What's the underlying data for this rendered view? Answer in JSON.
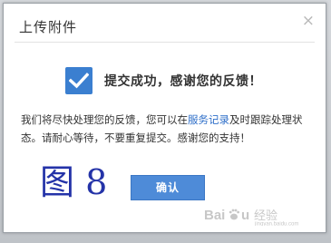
{
  "dialog": {
    "title": "上传附件",
    "close_glyph": "×",
    "success_message": "提交成功，感谢您的反馈！",
    "body_before_link": "我们将尽快处理您的反馈，您可以在",
    "body_link": "服务记录",
    "body_after_link": "及时跟踪处理状态。请耐心等待，不要重复提交。感谢您的支持！",
    "confirm_label": "确认"
  },
  "annotation": {
    "text": "图 8"
  },
  "watermark": {
    "text": "Bai 经验 jingyan.baidu.com"
  },
  "colors": {
    "accent": "#3b7fd0",
    "button": "#4e8bd8",
    "link": "#2f6fc9",
    "annotation": "#2433a8"
  },
  "icons": {
    "close": "close-icon",
    "success": "checkmark-icon",
    "watermark": "baidu-paw-logo"
  }
}
